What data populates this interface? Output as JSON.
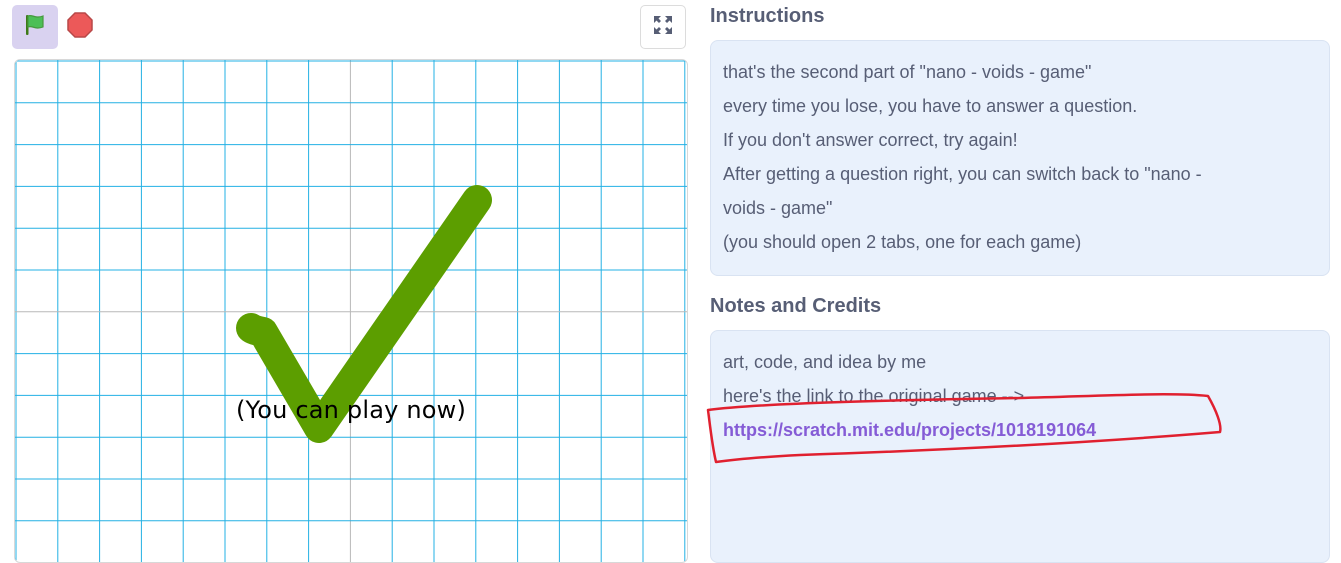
{
  "controls": {
    "green_flag_icon": "green-flag-icon",
    "stop_icon": "stop-sign-icon",
    "fullscreen_icon": "fullscreen-icon"
  },
  "stage": {
    "caption": "(You can play now)",
    "checkmark_color": "#5c9e00",
    "grid_color": "#23b0e4",
    "center_line_color": "#b8b8b8"
  },
  "instructions": {
    "title": "Instructions",
    "lines": [
      "that's the second part of \"nano - voids - game\"",
      "every time you lose, you have to answer a question.",
      "If you don't answer correct, try again!",
      "After getting a question right, you can switch back to \"nano -",
      "voids - game\"",
      "(you should open 2 tabs, one for each game)"
    ]
  },
  "notes": {
    "title": "Notes and Credits",
    "lines": [
      "art, code, and idea by me",
      "here's the link to the original game -->"
    ],
    "link": "https://scratch.mit.edu/projects/1018191064"
  },
  "colors": {
    "panel_bg": "#e9f1fc",
    "text": "#575e75",
    "link": "#855cd6",
    "annotation_red": "#e0202f"
  }
}
